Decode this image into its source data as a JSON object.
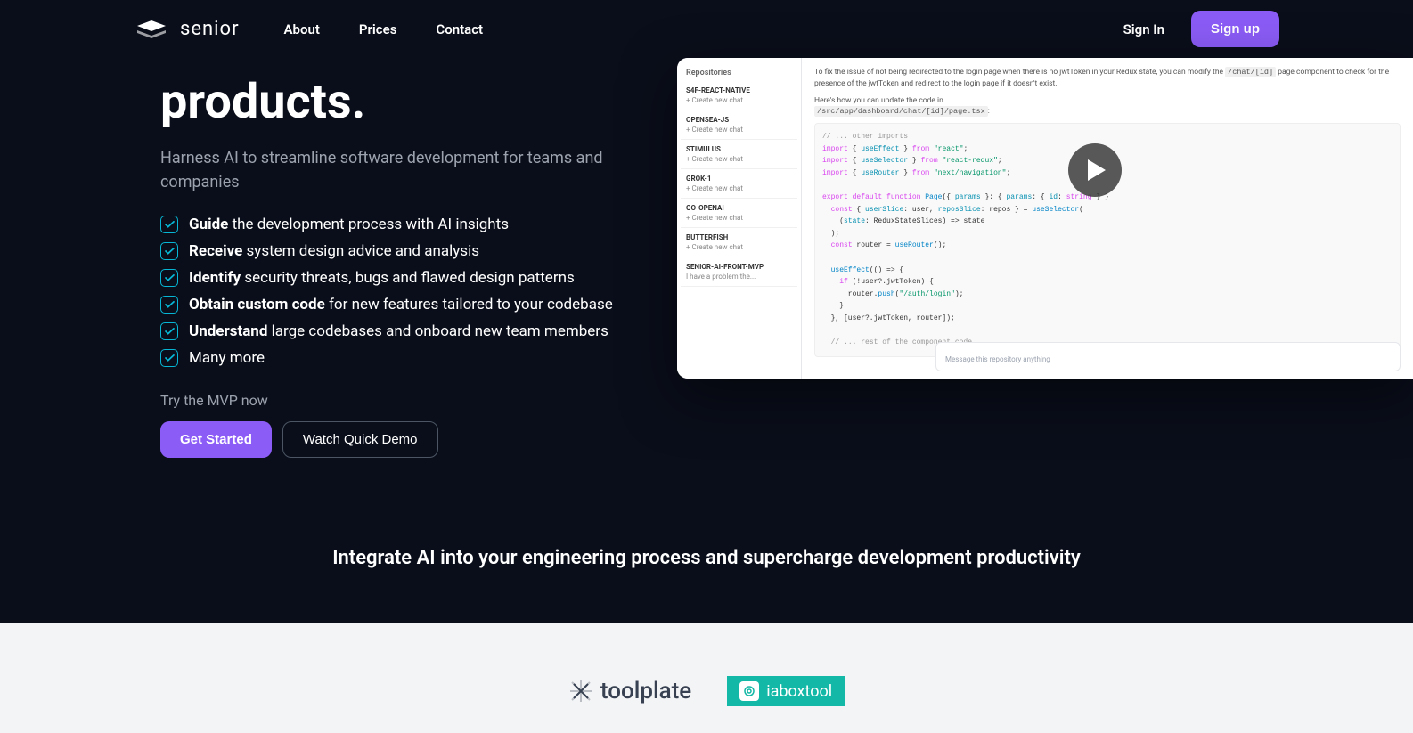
{
  "nav": {
    "logo_text": "senior",
    "links": [
      "About",
      "Prices",
      "Contact"
    ],
    "sign_in": "Sign In",
    "sign_up": "Sign up"
  },
  "hero": {
    "title": "products.",
    "subtitle": "Harness AI to streamline software development for teams and companies",
    "features": [
      {
        "bold": "Guide",
        "rest": " the development process with AI insights"
      },
      {
        "bold": "Receive",
        "rest": " system design advice and analysis"
      },
      {
        "bold": "Identify",
        "rest": " security threats, bugs and flawed design patterns"
      },
      {
        "bold": "Obtain custom code",
        "rest": " for new features tailored to your codebase"
      },
      {
        "bold": "Understand",
        "rest": " large codebases and onboard new team members"
      },
      {
        "bold": "",
        "rest": "Many more"
      }
    ],
    "cta_label": "Try the MVP now",
    "get_started": "Get Started",
    "watch_demo": "Watch Quick Demo"
  },
  "demo": {
    "sidebar_title": "Repositories",
    "repos": [
      {
        "name": "S4F-REACT-NATIVE",
        "sub": "+ Create new chat"
      },
      {
        "name": "OPENSEA-JS",
        "sub": "+ Create new chat"
      },
      {
        "name": "STIMULUS",
        "sub": "+ Create new chat"
      },
      {
        "name": "GROK-1",
        "sub": "+ Create new chat"
      },
      {
        "name": "GO-OPENAI",
        "sub": "+ Create new chat"
      },
      {
        "name": "BUTTERFISH",
        "sub": "+ Create new chat"
      },
      {
        "name": "SENIOR-AI-FRONT-MVP",
        "sub": "I have a problem the..."
      }
    ],
    "explanation_1": "To fix the issue of not being redirected to the login page when there is no jwtToken in your Redux state, you can modify the ",
    "explanation_code_1": "/chat/[id]",
    "explanation_2": " page component to check for the presence of the jwtToken and redirect to the login page if it doesn't exist.",
    "explanation_3": "Here's how you can update the code in",
    "explanation_code_2": "/src/app/dashboard/chat/[id]/page.tsx",
    "chat_placeholder": "Message this repository anything"
  },
  "tagline": "Integrate AI into your engineering process and supercharge development productivity",
  "partners": {
    "toolplate": "toolplate",
    "iabox": "iaboxtool"
  }
}
